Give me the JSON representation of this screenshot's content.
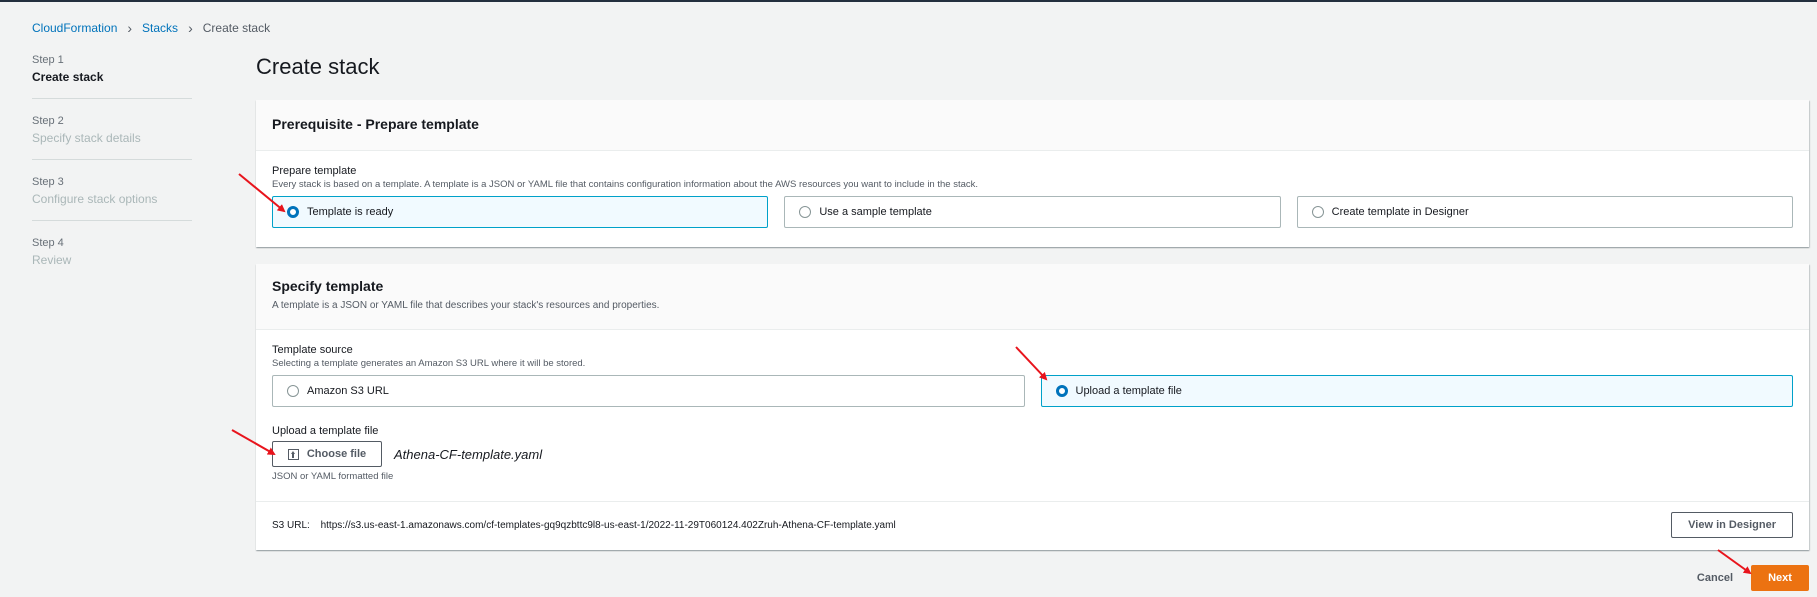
{
  "breadcrumb": {
    "root": "CloudFormation",
    "stacks": "Stacks",
    "current": "Create stack"
  },
  "steps": [
    {
      "num": "Step 1",
      "name": "Create stack"
    },
    {
      "num": "Step 2",
      "name": "Specify stack details"
    },
    {
      "num": "Step 3",
      "name": "Configure stack options"
    },
    {
      "num": "Step 4",
      "name": "Review"
    }
  ],
  "page_title": "Create stack",
  "prerequisite": {
    "heading": "Prerequisite - Prepare template",
    "label": "Prepare template",
    "description": "Every stack is based on a template. A template is a JSON or YAML file that contains configuration information about the AWS resources you want to include in the stack.",
    "options": [
      "Template is ready",
      "Use a sample template",
      "Create template in Designer"
    ],
    "selected": "Template is ready"
  },
  "specify": {
    "heading": "Specify template",
    "description": "A template is a JSON or YAML file that describes your stack's resources and properties.",
    "source_label": "Template source",
    "source_description": "Selecting a template generates an Amazon S3 URL where it will be stored.",
    "options": [
      "Amazon S3 URL",
      "Upload a template file"
    ],
    "selected": "Upload a template file",
    "upload_label": "Upload a template file",
    "choose_file": "Choose file",
    "file_name": "Athena-CF-template.yaml",
    "upload_hint": "JSON or YAML formatted file",
    "s3_label": "S3 URL:",
    "s3_url": "https://s3.us-east-1.amazonaws.com/cf-templates-gq9qzbttc9l8-us-east-1/2022-11-29T060124.402Zruh-Athena-CF-template.yaml",
    "view_designer": "View in Designer"
  },
  "actions": {
    "cancel": "Cancel",
    "next": "Next"
  },
  "colors": {
    "accent": "#0073bb",
    "primary_button": "#ec7211",
    "annotation_arrow": "#e8141c"
  }
}
